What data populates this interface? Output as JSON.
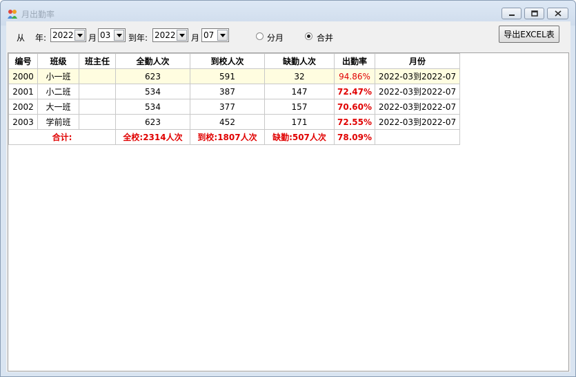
{
  "window": {
    "title": "月出勤率"
  },
  "toolbar": {
    "from_label": "从",
    "year_label": "年:",
    "from_year": "2022",
    "month_label": "月",
    "from_month": "03",
    "to_year_label": "到年:",
    "to_year": "2022",
    "to_month_label": "月",
    "to_month": "07",
    "radio_by_month": "分月",
    "radio_merge": "合并",
    "selected_mode": "合并",
    "export_label": "导出EXCEL表"
  },
  "table": {
    "headers": [
      "编号",
      "班级",
      "班主任",
      "全勤人次",
      "到校人次",
      "缺勤人次",
      "出勤率",
      "月份"
    ],
    "rows": [
      {
        "id": "2000",
        "class": "小一班",
        "teacher": "",
        "full": "623",
        "arrived": "591",
        "absent": "32",
        "rate": "94.86%",
        "month": "2022-03到2022-07"
      },
      {
        "id": "2001",
        "class": "小二班",
        "teacher": "",
        "full": "534",
        "arrived": "387",
        "absent": "147",
        "rate": "72.47%",
        "month": "2022-03到2022-07"
      },
      {
        "id": "2002",
        "class": "大一班",
        "teacher": "",
        "full": "534",
        "arrived": "377",
        "absent": "157",
        "rate": "70.60%",
        "month": "2022-03到2022-07"
      },
      {
        "id": "2003",
        "class": "学前班",
        "teacher": "",
        "full": "623",
        "arrived": "452",
        "absent": "171",
        "rate": "72.55%",
        "month": "2022-03到2022-07"
      }
    ],
    "total": {
      "label": "合计:",
      "full": "全校:2314人次",
      "arrived": "到校:1807人次",
      "absent": "缺勤:507人次",
      "rate": "78.09%"
    }
  },
  "colors": {
    "highlight_row": "#fffde0",
    "emphasis": "#e00000",
    "titlebar": "#d9e4f1"
  },
  "icons": {
    "app": "people-icon",
    "minimize": "minimize-icon",
    "maximize": "maximize-icon",
    "close": "close-icon"
  }
}
